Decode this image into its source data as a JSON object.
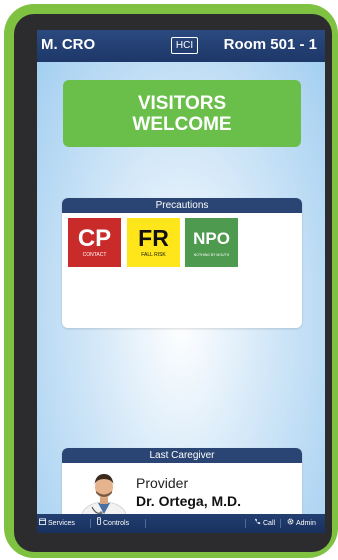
{
  "header": {
    "patient": "M. CRO",
    "brand": "HCI",
    "room": "Room 501 - 1"
  },
  "banner": {
    "line1": "VISITORS",
    "line2": "WELCOME",
    "color": "#6abf4b"
  },
  "precautions": {
    "title": "Precautions",
    "items": [
      {
        "code": "CP",
        "label": "CONTACT",
        "color": "#c92a2a"
      },
      {
        "code": "FR",
        "label": "FALL RISK",
        "color": "#ffe61a"
      },
      {
        "code": "NPO",
        "label": "NOTHING BY MOUTH",
        "color": "#4e9a4f"
      }
    ]
  },
  "caregiver": {
    "title": "Last Caregiver",
    "role": "Provider",
    "name": "Dr. Ortega, M.D.",
    "avatar_icon": "doctor-avatar"
  },
  "bottom_nav": {
    "services": {
      "label": "Services",
      "icon": "calendar-icon"
    },
    "controls": {
      "label": "Controls",
      "icon": "remote-icon"
    },
    "call": {
      "label": "Call",
      "icon": "phone-icon"
    },
    "admin": {
      "label": "Admin",
      "icon": "gear-icon"
    }
  },
  "theme": {
    "bezel": "#7fc241",
    "bar": "#1d3768"
  }
}
